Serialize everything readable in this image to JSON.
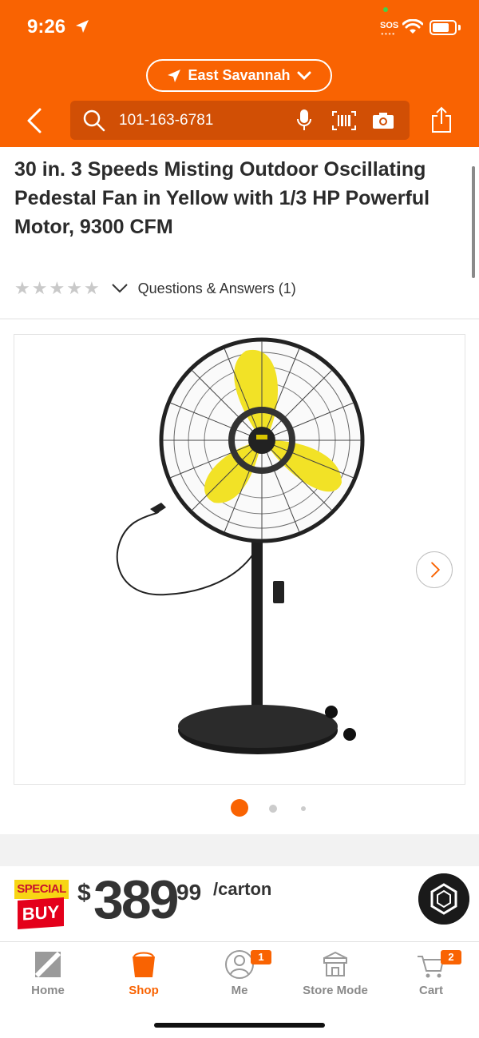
{
  "status_bar": {
    "time": "9:26",
    "sos": "SOS"
  },
  "header": {
    "location": "East Savannah",
    "search_value": "101-163-6781"
  },
  "product": {
    "title": "30 in. 3 Speeds Misting Outdoor Oscillating Pedestal Fan in Yellow with 1/3 HP Powerful Motor, 9300 CFM",
    "rating": 0,
    "rating_max": 5,
    "qa_label": "Questions & Answers (1)"
  },
  "gallery": {
    "image_count": 3,
    "active_index": 0
  },
  "badge": {
    "top": "SPECIAL",
    "bottom": "BUY"
  },
  "price": {
    "currency": "$",
    "dollars": "389",
    "cents": "99",
    "unit": "/carton"
  },
  "tabbar": {
    "items": [
      {
        "label": "Home",
        "icon": "home-depot-logo-icon"
      },
      {
        "label": "Shop",
        "icon": "shop-bucket-icon"
      },
      {
        "label": "Me",
        "icon": "person-icon",
        "badge": "1"
      },
      {
        "label": "Store Mode",
        "icon": "store-icon"
      },
      {
        "label": "Cart",
        "icon": "cart-icon",
        "badge": "2"
      }
    ],
    "active": "Shop"
  },
  "colors": {
    "brand": "#f96302",
    "special_yellow": "#f7d614",
    "special_red": "#e4001b"
  }
}
